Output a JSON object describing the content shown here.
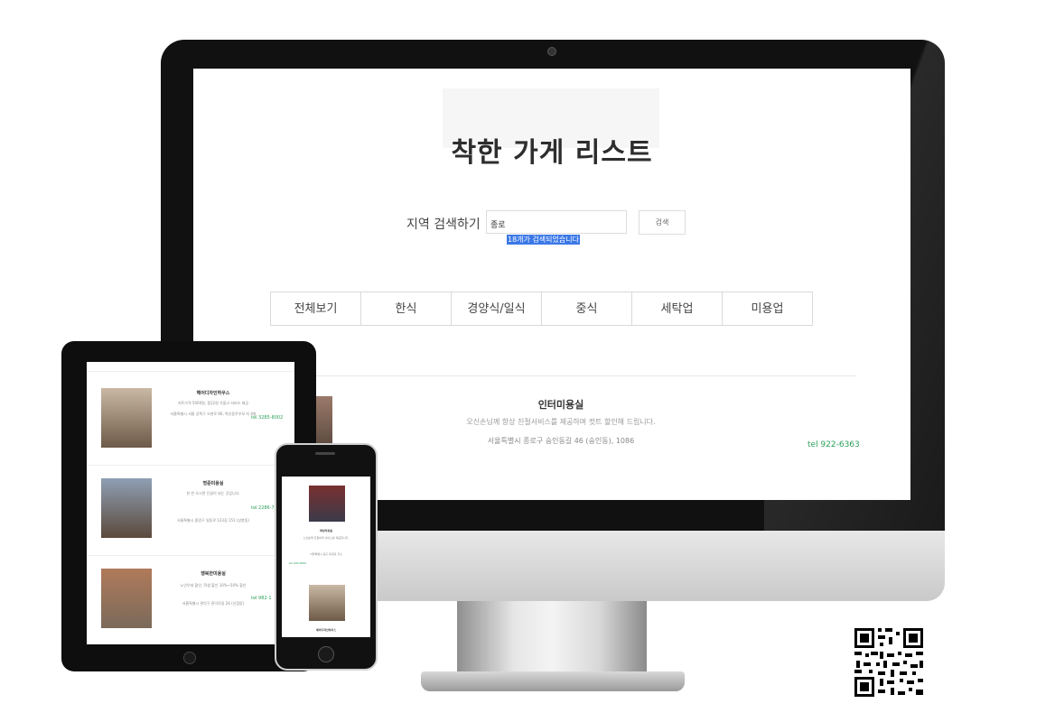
{
  "desktop": {
    "page_title": "착한 가게 리스트",
    "search": {
      "label": "지역 검색하기",
      "value": "종로",
      "button_label": "검색",
      "result_text": "18개가 검색되었습니다"
    },
    "categories": [
      "전체보기",
      "한식",
      "경양식/일식",
      "중식",
      "세탁업",
      "미용업"
    ],
    "store": {
      "name": "인터미용실",
      "description": "오신손님께 항상 친절서비스를 제공하며 컷트 할인해 드립니다.",
      "address": "서울특별시 종로구 숭인동길 46 (숭인동), 1086",
      "tel": "tel 922-6363"
    }
  },
  "tablet": {
    "stores": [
      {
        "name": "헤어디자인하우스",
        "desc": "커트가격 5000원, 펌12원 가을고 서비스 제공",
        "address": "서울특별시 서울 강북구 오현로 66, 북신동주우모 지 4층",
        "tel": "tel 3285-8002"
      },
      {
        "name": "명준미용실",
        "desc": "한 번 오시면 단골이 되는 곳입니다.",
        "address": "서울특별시 중랑구 일동로 123길 151 (상봉동)",
        "tel": "tel 2286-7"
      },
      {
        "name": "행복한미용실",
        "desc": "노인우대 할인, 학생 할인 10%~50% 할인",
        "address": "서울특별시 관악구 관악로길 24 (신림동)",
        "tel": "tel 982-1"
      }
    ]
  },
  "phone": {
    "stores": [
      {
        "name": "화성미용실",
        "desc": "노인분께 친절하게 서비스를 제공합니다.",
        "address": "서울특별시 중구 퇴계로 주소",
        "tel": "tel 000-0000"
      },
      {
        "name": "헤어디자인하우스"
      }
    ]
  },
  "colors": {
    "accent_green": "#2ca05a",
    "highlight_blue": "#3b78e7",
    "bezel": "#111111"
  },
  "icons": [
    "qr-code-icon",
    "camera-icon",
    "home-button-icon"
  ]
}
